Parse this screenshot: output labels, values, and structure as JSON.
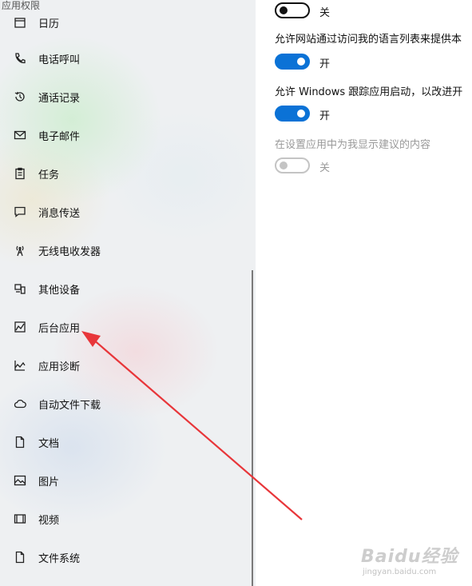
{
  "sidebar": {
    "section_header": "应用权限",
    "items": [
      {
        "label": "日历",
        "icon": "calendar-icon"
      },
      {
        "label": "电话呼叫",
        "icon": "phone-icon"
      },
      {
        "label": "通话记录",
        "icon": "history-icon"
      },
      {
        "label": "电子邮件",
        "icon": "mail-icon"
      },
      {
        "label": "任务",
        "icon": "clipboard-icon"
      },
      {
        "label": "消息传送",
        "icon": "chat-icon"
      },
      {
        "label": "无线电收发器",
        "icon": "antenna-icon"
      },
      {
        "label": "其他设备",
        "icon": "devices-icon"
      },
      {
        "label": "后台应用",
        "icon": "background-apps-icon"
      },
      {
        "label": "应用诊断",
        "icon": "diagnostics-icon"
      },
      {
        "label": "自动文件下载",
        "icon": "cloud-icon"
      },
      {
        "label": "文档",
        "icon": "document-icon"
      },
      {
        "label": "图片",
        "icon": "image-icon"
      },
      {
        "label": "视频",
        "icon": "video-icon"
      },
      {
        "label": "文件系统",
        "icon": "file-icon"
      }
    ]
  },
  "settings": [
    {
      "description": "",
      "state": "off",
      "state_label": "关"
    },
    {
      "description": "允许网站通过访问我的语言列表来提供本",
      "state": "on",
      "state_label": "开"
    },
    {
      "description": "允许 Windows 跟踪应用启动，以改进开",
      "state": "on",
      "state_label": "开"
    },
    {
      "description": "在设置应用中为我显示建议的内容",
      "state": "disabled",
      "state_label": "关"
    }
  ],
  "annotation": {
    "color": "#e8363a"
  },
  "watermark": {
    "logo": "Baidu经验",
    "sub": "jingyan.baidu.com"
  },
  "colors": {
    "accent": "#0b72d6",
    "text": "#111111",
    "disabled": "#9a9a9a"
  }
}
